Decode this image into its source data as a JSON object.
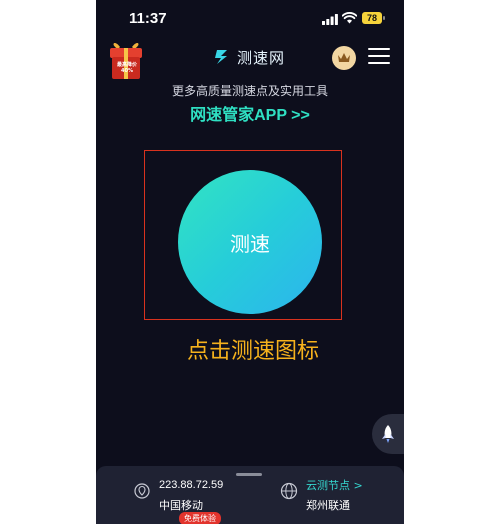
{
  "status_bar": {
    "time": "11:37",
    "battery": "78"
  },
  "header": {
    "gift_text": "最高降价 40%",
    "logo_text": "测速网"
  },
  "promo": {
    "subtitle": "更多高质量测速点及实用工具",
    "app_link": "网速管家APP >>"
  },
  "speed_test": {
    "button_label": "测速",
    "instruction": "点击测速图标"
  },
  "bottom_panel": {
    "ip_address": "223.88.72.59",
    "isp": "中国移动",
    "trial_badge": "免费体验",
    "node_link": "云测节点 >",
    "node_value": "郑州联通"
  },
  "colors": {
    "background": "#0d0e1c",
    "accent_teal": "#2fe0c3",
    "instruction_orange": "#f6b21c",
    "highlight_red": "#d8321e",
    "badge_red": "#e2342d"
  },
  "icons": [
    "signal-icon",
    "wifi-icon",
    "battery-icon",
    "gift-icon",
    "logo-icon",
    "crown-icon",
    "menu-icon",
    "rocket-icon",
    "location-pin-icon",
    "globe-icon"
  ]
}
